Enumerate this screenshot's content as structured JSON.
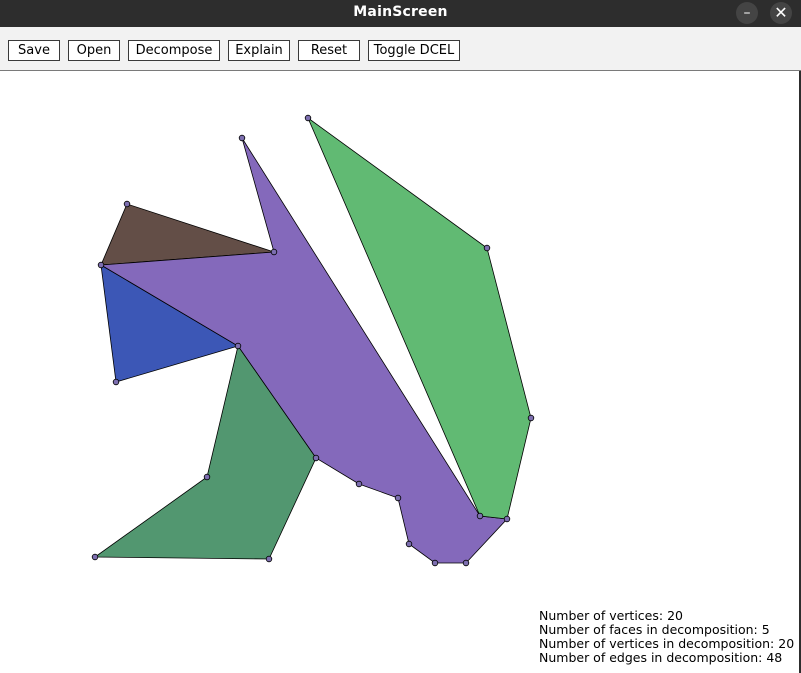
{
  "window": {
    "title": "MainScreen",
    "minimize_icon": "minimize-icon",
    "close_icon": "close-icon",
    "minimize_glyph": "–",
    "close_glyph": "✕"
  },
  "toolbar": {
    "buttons": [
      {
        "label": "Save"
      },
      {
        "label": "Open"
      },
      {
        "label": "Decompose"
      },
      {
        "label": "Explain"
      },
      {
        "label": "Reset"
      },
      {
        "label": "Toggle DCEL"
      }
    ]
  },
  "faces": [
    {
      "name": "brown-face",
      "color": "#634e47"
    },
    {
      "name": "blue-face",
      "color": "#3c57b6"
    },
    {
      "name": "purple-face",
      "color": "#8469bb"
    },
    {
      "name": "dark-green-face",
      "color": "#529770"
    },
    {
      "name": "light-green-face",
      "color": "#61ba73"
    }
  ],
  "stats": {
    "vertices": "Number of vertices: 20",
    "faces": "Number of faces in decomposition: 5",
    "decomp_vertices": "Number of vertices in decomposition: 20",
    "decomp_edges": "Number of edges in decomposition: 48"
  }
}
